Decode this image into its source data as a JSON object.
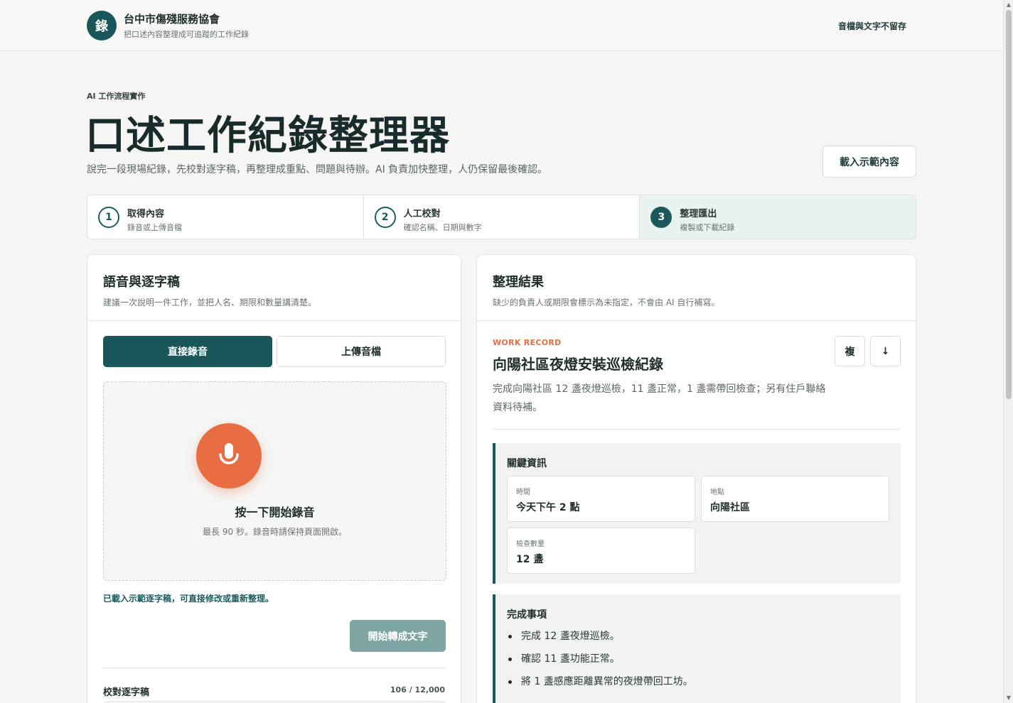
{
  "header": {
    "logo_char": "錄",
    "org_name": "台中市傷殘服務協會",
    "org_subtitle": "把口述內容整理成可追蹤的工作紀錄",
    "privacy_note": "音檔與文字不留存"
  },
  "hero": {
    "eyebrow": "AI 工作流程實作",
    "title": "口述工作紀錄整理器",
    "description": "說完一段現場紀錄，先校對逐字稿，再整理成重點、問題與待辦。AI 負責加快整理，人仍保留最後確認。",
    "demo_button": "載入示範內容"
  },
  "steps": [
    {
      "num": "1",
      "title": "取得內容",
      "subtitle": "錄音或上傳音檔",
      "active": false
    },
    {
      "num": "2",
      "title": "人工校對",
      "subtitle": "確認名稱、日期與數字",
      "active": false
    },
    {
      "num": "3",
      "title": "整理匯出",
      "subtitle": "複製或下載紀錄",
      "active": true
    }
  ],
  "left_panel": {
    "title": "語音與逐字稿",
    "subtitle": "建議一次說明一件工作，並把人名、期限和數量講清楚。",
    "tab_record": "直接錄音",
    "tab_upload": "上傳音檔",
    "record_title": "按一下開始錄音",
    "record_hint": "最長 90 秒。錄音時請保持頁面開啟。",
    "loaded_message": "已載入示範逐字稿，可直接修改或重新整理。",
    "convert_button": "開始轉成文字",
    "transcript_label": "校對逐字稿",
    "transcript_count": "106 / 12,000"
  },
  "right_panel": {
    "title": "整理結果",
    "subtitle": "缺少的負責人或期限會標示為未指定，不會由 AI 自行補寫。",
    "record_label": "WORK RECORD",
    "record_title": "向陽社區夜燈安裝巡檢紀錄",
    "record_summary": "完成向陽社區 12 盞夜燈巡檢，11 盞正常，1 盞需帶回檢查；另有住戶聯絡資料待補。",
    "copy_button": "複",
    "download_button": "↓",
    "key_info": {
      "title": "關鍵資訊",
      "items": [
        {
          "key": "時間",
          "value": "今天下午 2 點"
        },
        {
          "key": "地點",
          "value": "向陽社區"
        },
        {
          "key": "檢查數量",
          "value": "12 盞"
        }
      ]
    },
    "completed": {
      "title": "完成事項",
      "items": [
        "完成 12 盞夜燈巡檢。",
        "確認 11 盞功能正常。",
        "將 1 盞感應距離異常的夜燈帶回工坊。"
      ]
    }
  },
  "colors": {
    "primary": "#19575a",
    "accent": "#e96d43",
    "active_step_bg": "#e8f2ef"
  },
  "icons": {
    "mic": "microphone-icon",
    "copy": "copy-icon",
    "download": "download-arrow-icon"
  }
}
